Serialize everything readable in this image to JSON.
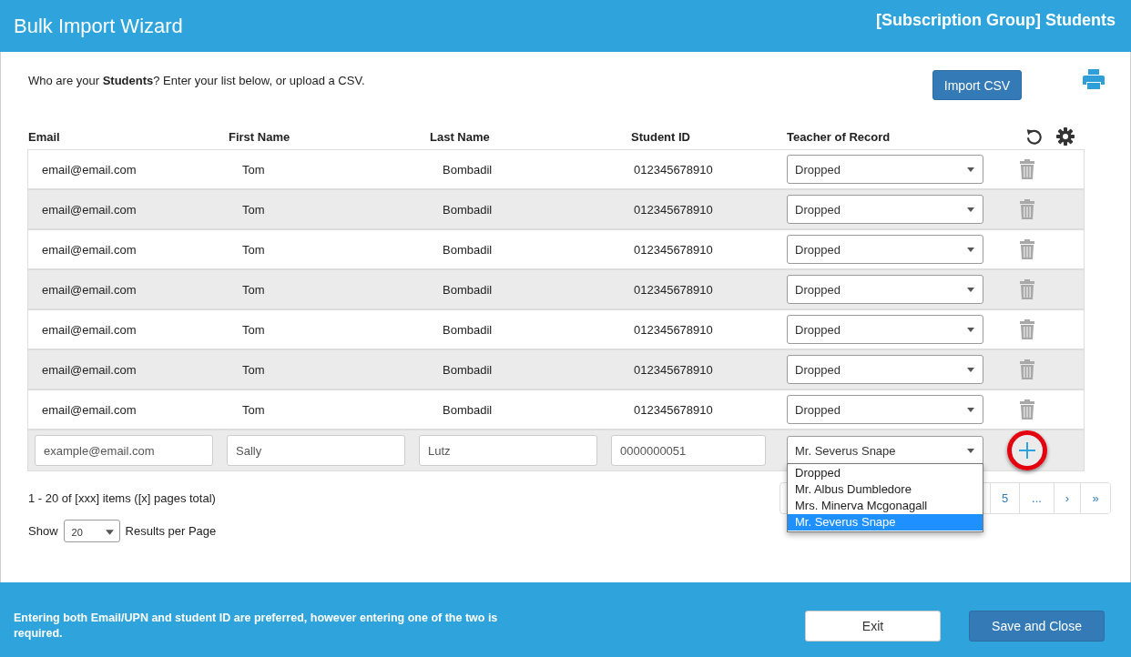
{
  "header": {
    "title": "Bulk Import Wizard",
    "group_title": "[Subscription Group] Students"
  },
  "intro": "Who are your **Students**? Enter your list below, or upload a CSV.",
  "import_button": "Import CSV",
  "table": {
    "columns": [
      "Email",
      "First Name",
      "Last Name",
      "Student ID",
      "Teacher of Record"
    ],
    "rows": [
      {
        "email": "email@email.com",
        "first_name": "Tom",
        "last_name": "Bombadil",
        "student_id": "012345678910",
        "teacher": "Dropped"
      },
      {
        "email": "email@email.com",
        "first_name": "Tom",
        "last_name": "Bombadil",
        "student_id": "012345678910",
        "teacher": "Dropped"
      },
      {
        "email": "email@email.com",
        "first_name": "Tom",
        "last_name": "Bombadil",
        "student_id": "012345678910",
        "teacher": "Dropped"
      },
      {
        "email": "email@email.com",
        "first_name": "Tom",
        "last_name": "Bombadil",
        "student_id": "012345678910",
        "teacher": "Dropped"
      },
      {
        "email": "email@email.com",
        "first_name": "Tom",
        "last_name": "Bombadil",
        "student_id": "012345678910",
        "teacher": "Dropped"
      },
      {
        "email": "email@email.com",
        "first_name": "Tom",
        "last_name": "Bombadil",
        "student_id": "012345678910",
        "teacher": "Dropped"
      },
      {
        "email": "email@email.com",
        "first_name": "Tom",
        "last_name": "Bombadil",
        "student_id": "012345678910",
        "teacher": "Dropped"
      }
    ],
    "new_row": {
      "email": {
        "placeholder": "example@email.com"
      },
      "first_name": "Sally",
      "last_name": "Lutz",
      "student_id": "0000000051",
      "teacher": "Mr. Severus Snape",
      "teacher_expanded": true,
      "teacher_options": [
        {
          "label": "Dropped",
          "selected": false
        },
        {
          "label": "Mr. Albus Dumbledore",
          "selected": false
        },
        {
          "label": "Mrs. Minerva Mcgonagall",
          "selected": false
        },
        {
          "label": "Mr. Severus Snape",
          "selected": true
        }
      ],
      "add_highlighted": true
    }
  },
  "summary": "1 - 20 of [xxx] items ([x] pages total)",
  "pagination": [
    {
      "label": "5",
      "kind": "page"
    },
    {
      "label": "...",
      "kind": "gap"
    },
    {
      "label": "›",
      "kind": "next"
    },
    {
      "label": "»",
      "kind": "last"
    }
  ],
  "page_size": {
    "label_before": "Show",
    "value": "20",
    "label_after": "Results per Page"
  },
  "footer": {
    "note": "Entering both Email/UPN and student ID are preferred, however entering one of the two is required.",
    "buttons": [
      {
        "label": "Exit",
        "kind": "secondary"
      },
      {
        "label": "Save and Close",
        "kind": "primary"
      }
    ]
  }
}
